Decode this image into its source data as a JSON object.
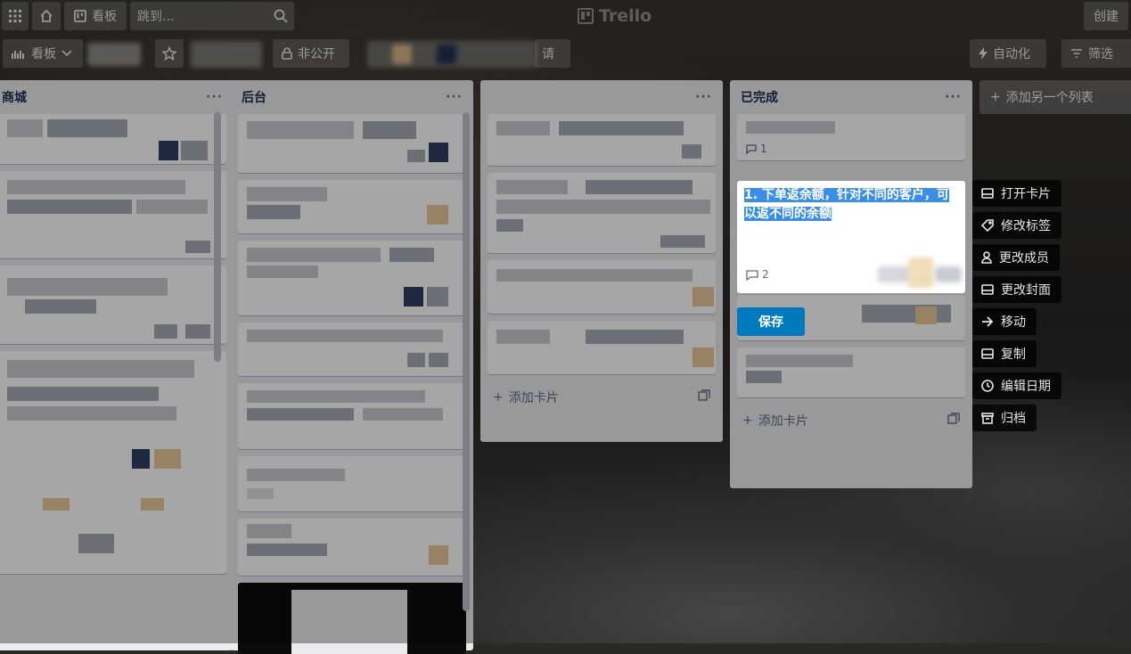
{
  "header": {
    "board_button": "看板",
    "search_placeholder": "跳到...",
    "logo_text": "Trello",
    "create_button": "创建"
  },
  "board_bar": {
    "view_label": "看板",
    "visibility": "非公开",
    "invite": "请",
    "automation": "自动化",
    "filter": "筛选"
  },
  "lists": [
    {
      "title": "商城"
    },
    {
      "title": "后台"
    },
    {
      "title": ""
    },
    {
      "title": "已完成"
    }
  ],
  "list_menu_glyph": "···",
  "add_card_label": "添加卡片",
  "add_list_label": "添加另一个列表",
  "done_list": {
    "first_card_comments": "1",
    "after_card_comments": ""
  },
  "edit_card": {
    "text": "1. 下单返余额，针对不同的客户，可以返不同的余额",
    "comments": "2",
    "save_label": "保存"
  },
  "card_actions": [
    {
      "label": "打开卡片",
      "icon": "card-icon"
    },
    {
      "label": "修改标签",
      "icon": "tag-icon"
    },
    {
      "label": "更改成员",
      "icon": "person-icon"
    },
    {
      "label": "更改封面",
      "icon": "cover-icon"
    },
    {
      "label": "移动",
      "icon": "arrow-right-icon"
    },
    {
      "label": "复制",
      "icon": "copy-icon"
    },
    {
      "label": "编辑日期",
      "icon": "clock-icon"
    },
    {
      "label": "归档",
      "icon": "archive-icon"
    }
  ]
}
